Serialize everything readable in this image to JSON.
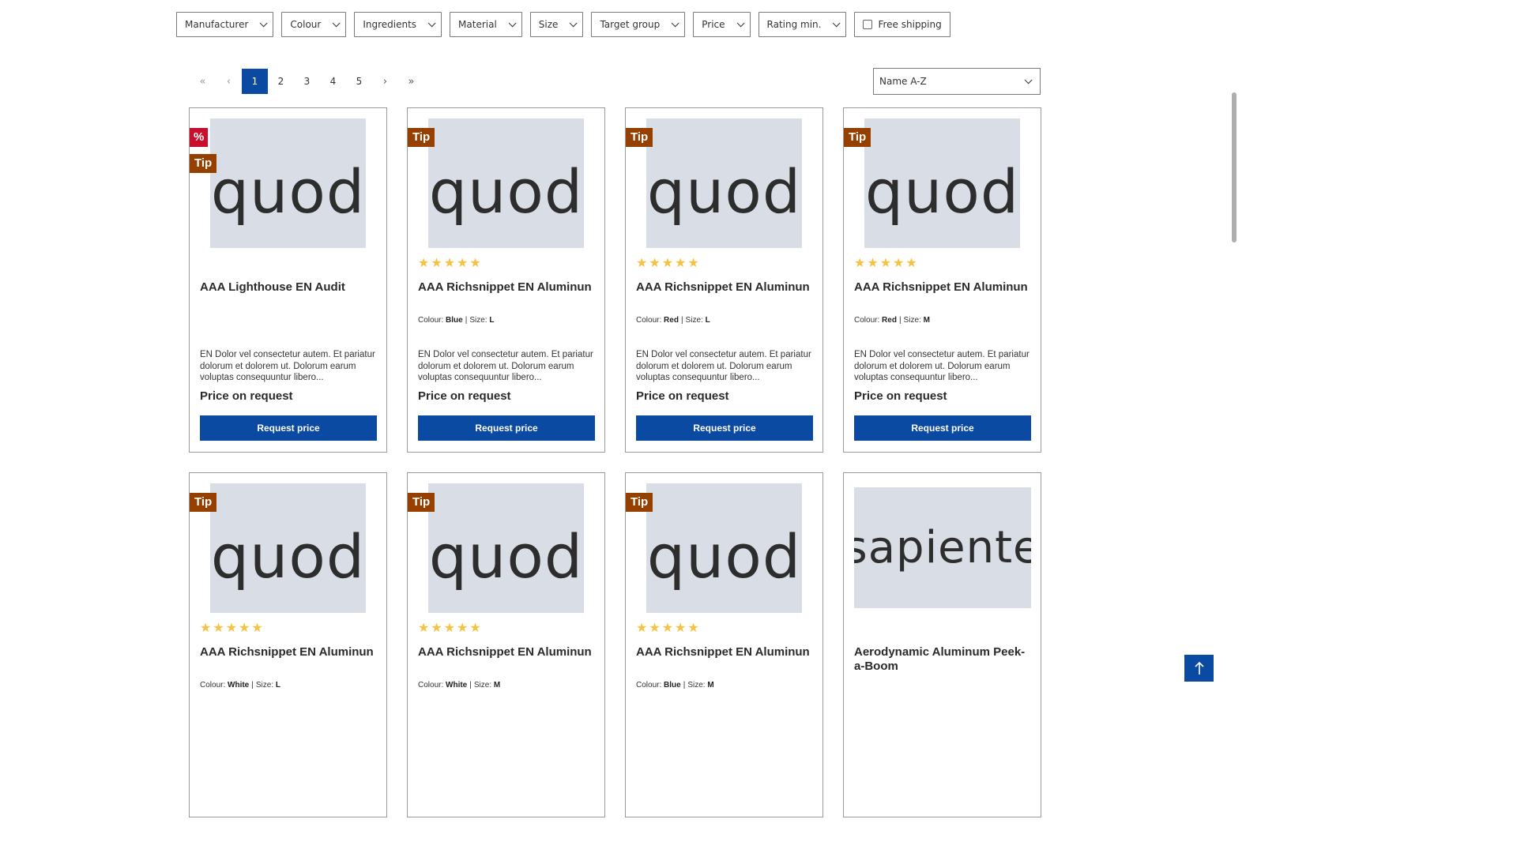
{
  "filters": [
    {
      "label": "Manufacturer"
    },
    {
      "label": "Colour"
    },
    {
      "label": "Ingredients"
    },
    {
      "label": "Material"
    },
    {
      "label": "Size"
    },
    {
      "label": "Target group"
    },
    {
      "label": "Price"
    },
    {
      "label": "Rating min."
    }
  ],
  "free_shipping": {
    "label": "Free shipping",
    "checked": false
  },
  "pagination": {
    "first": "«",
    "prev": "‹",
    "pages": [
      "1",
      "2",
      "3",
      "4",
      "5"
    ],
    "current": "1",
    "next": "›",
    "last": "»"
  },
  "sort": {
    "selected": "Name A-Z"
  },
  "labels": {
    "colour": "Colour:",
    "size": "Size:",
    "separator": "|"
  },
  "products": [
    {
      "image_text": "quod",
      "badges": [
        "%",
        "Tip"
      ],
      "rating": 0,
      "title": "AAA Lighthouse EN Audit",
      "colour": "",
      "size": "",
      "description": "EN Dolor vel consectetur autem. Et pariatur dolorum et dolorem ut. Dolorum earum voluptas consequuntur libero...",
      "price": "Price on request",
      "button": "Request price"
    },
    {
      "image_text": "quod",
      "badges": [
        "Tip"
      ],
      "rating": 5,
      "title": "AAA Richsnippet EN Aluminun",
      "colour": "Blue",
      "size": "L",
      "description": "EN Dolor vel consectetur autem. Et pariatur dolorum et dolorem ut. Dolorum earum voluptas consequuntur libero...",
      "price": "Price on request",
      "button": "Request price"
    },
    {
      "image_text": "quod",
      "badges": [
        "Tip"
      ],
      "rating": 5,
      "title": "AAA Richsnippet EN Aluminun",
      "colour": "Red",
      "size": "L",
      "description": "EN Dolor vel consectetur autem. Et pariatur dolorum et dolorem ut. Dolorum earum voluptas consequuntur libero...",
      "price": "Price on request",
      "button": "Request price"
    },
    {
      "image_text": "quod",
      "badges": [
        "Tip"
      ],
      "rating": 5,
      "title": "AAA Richsnippet EN Aluminun",
      "colour": "Red",
      "size": "M",
      "description": "EN Dolor vel consectetur autem. Et pariatur dolorum et dolorem ut. Dolorum earum voluptas consequuntur libero...",
      "price": "Price on request",
      "button": "Request price"
    },
    {
      "image_text": "quod",
      "badges": [
        "Tip"
      ],
      "rating": 5,
      "title": "AAA Richsnippet EN Aluminun",
      "colour": "White",
      "size": "L",
      "description": "",
      "price": "",
      "button": ""
    },
    {
      "image_text": "quod",
      "badges": [
        "Tip"
      ],
      "rating": 5,
      "title": "AAA Richsnippet EN Aluminun",
      "colour": "White",
      "size": "M",
      "description": "",
      "price": "",
      "button": ""
    },
    {
      "image_text": "quod",
      "badges": [
        "Tip"
      ],
      "rating": 5,
      "title": "AAA Richsnippet EN Aluminun",
      "colour": "Blue",
      "size": "M",
      "description": "",
      "price": "",
      "button": ""
    },
    {
      "image_text": "sapiente",
      "badges": [],
      "rating": 0,
      "title": "Aerodynamic Aluminum Peek-a-Boom",
      "colour": "",
      "size": "",
      "description": "",
      "price": "",
      "button": ""
    }
  ],
  "colors": {
    "primary": "#0b4aa2",
    "tip_badge": "#964000",
    "sale_badge": "#c8102e",
    "star": "#f5c242",
    "image_placeholder": "#d9dde6"
  },
  "icons": {
    "filter_chevron": "chevron-down-icon",
    "star": "star-icon",
    "back_to_top": "arrow-up-icon"
  }
}
